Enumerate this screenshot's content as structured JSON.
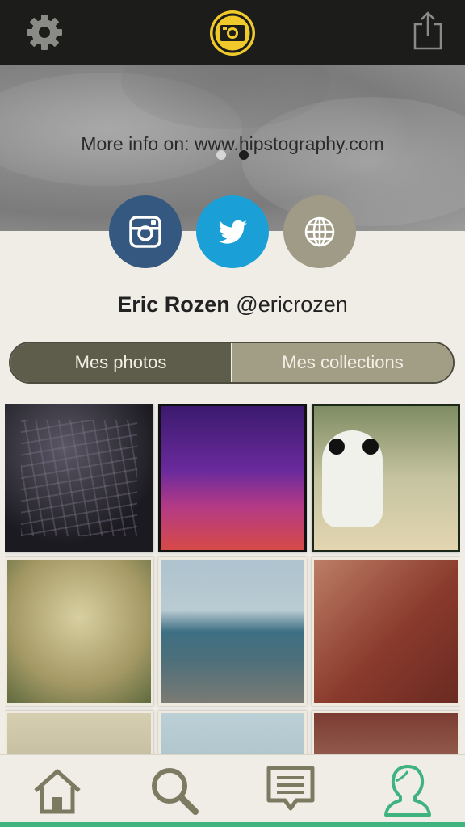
{
  "header": {
    "settings_icon": "gear-icon",
    "logo_icon": "hipstography-logo",
    "share_icon": "share-icon"
  },
  "banner": {
    "page_dots": {
      "count": 2,
      "active_index": 1
    },
    "info_text": "More info on: www.hipstography.com"
  },
  "social": [
    {
      "name": "instagram",
      "icon": "instagram-icon",
      "color": "#34587f"
    },
    {
      "name": "twitter",
      "icon": "twitter-icon",
      "color": "#1aa0d7"
    },
    {
      "name": "website",
      "icon": "globe-icon",
      "color": "#a09b86"
    }
  ],
  "profile": {
    "name": "Eric Rozen",
    "handle": "@ericrozen"
  },
  "segmented": {
    "tabs": [
      "Mes photos",
      "Mes collections"
    ],
    "selected": "Mes photos"
  },
  "photos_count_visible": 9,
  "tabbar": {
    "items": [
      {
        "icon": "home-icon",
        "active": false
      },
      {
        "icon": "search-icon",
        "active": false
      },
      {
        "icon": "chat-icon",
        "active": false
      },
      {
        "icon": "profile-icon",
        "active": true
      }
    ],
    "accent": "#3fb37f",
    "inactive_color": "#7d7a62"
  }
}
